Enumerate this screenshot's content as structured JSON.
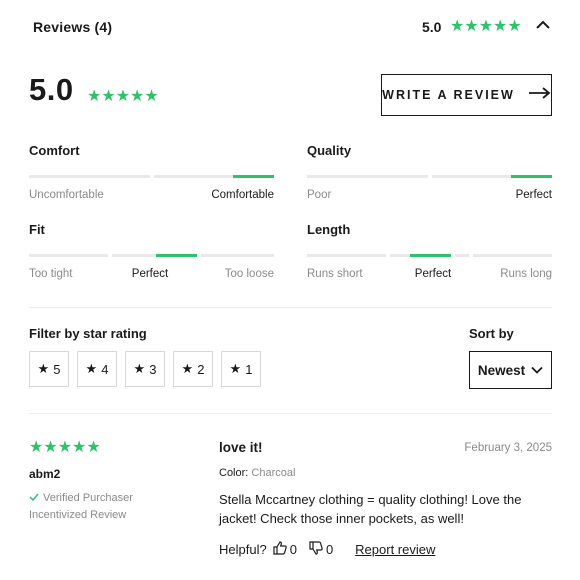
{
  "header": {
    "title": "Reviews (4)",
    "score": "5.0",
    "stars": "★★★★★"
  },
  "overall": {
    "score": "5.0",
    "stars": "★★★★★",
    "write_review_label": "WRITE A REVIEW"
  },
  "attributes": {
    "comfort": {
      "title": "Comfort",
      "low": "Uncomfortable",
      "high": "Comfortable",
      "selected": "Comfortable"
    },
    "quality": {
      "title": "Quality",
      "low": "Poor",
      "high": "Perfect",
      "selected": "Perfect"
    },
    "fit": {
      "title": "Fit",
      "low": "Too tight",
      "mid": "Perfect",
      "high": "Too loose",
      "selected": "Perfect"
    },
    "length": {
      "title": "Length",
      "low": "Runs short",
      "mid": "Perfect",
      "high": "Runs long",
      "selected": "Perfect"
    }
  },
  "filter": {
    "title": "Filter by star rating",
    "options": [
      "5",
      "4",
      "3",
      "2",
      "1"
    ],
    "star_glyph": "★"
  },
  "sort": {
    "title": "Sort by",
    "selected": "Newest"
  },
  "review": {
    "stars": "★★★★★",
    "author": "abm2",
    "verified": "Verified Purchaser",
    "incentivized": "Incentivized Review",
    "title": "love it!",
    "date": "February 3, 2025",
    "color_label": "Color:",
    "color_value": "Charcoal",
    "body": "Stella Mccartney clothing = quality clothing! Love the jacket! Check those inner pockets, as well!",
    "helpful_label": "Helpful?",
    "up_count": "0",
    "down_count": "0",
    "report_label": "Report review"
  },
  "colors": {
    "accent": "#2fc26a",
    "text": "#1a1a1a",
    "muted": "#8a8a8a",
    "track": "#e9e9e9"
  }
}
